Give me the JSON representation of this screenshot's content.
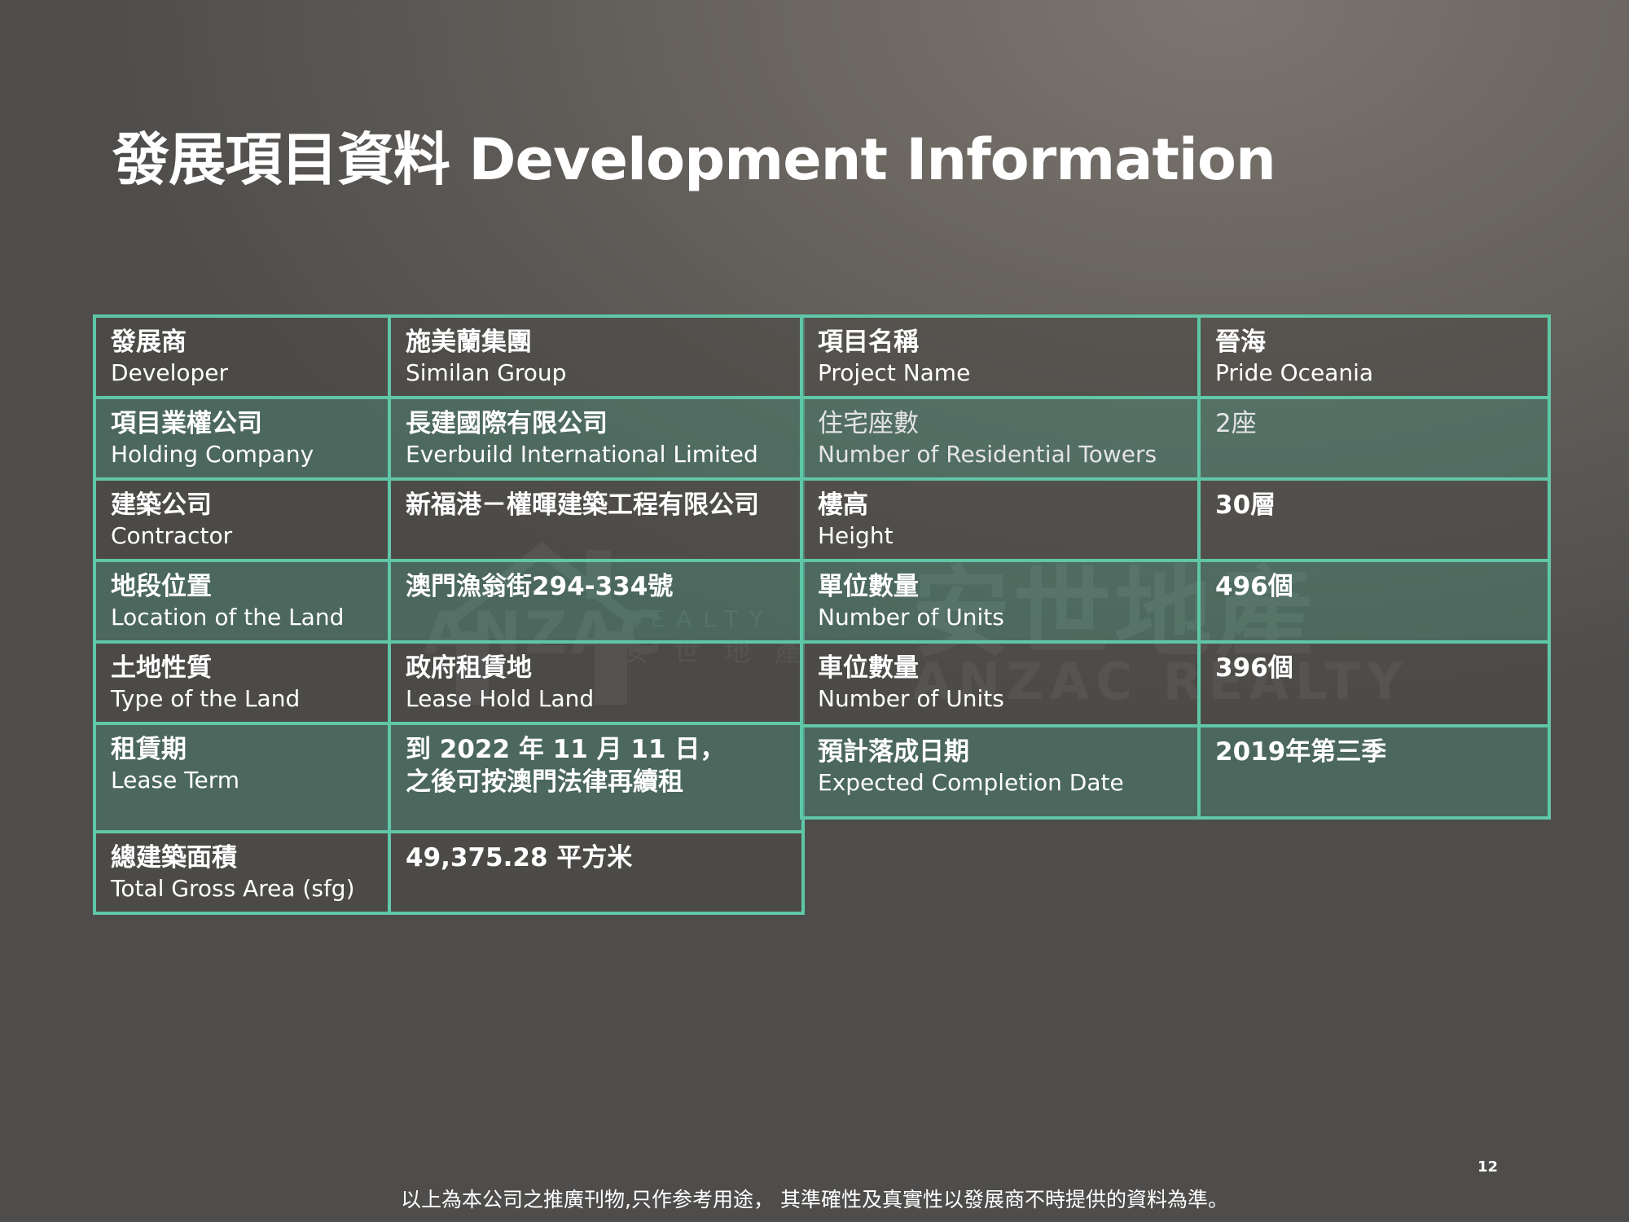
{
  "page": {
    "title": "發展項目資料 Development Information",
    "footer_note": "以上為本公司之推廣刊物,只作参考用途， 其準確性及真實性以發展商不時提供的資料為準。",
    "page_number": "12",
    "accent_color": "#5fc7a7"
  },
  "watermark": {
    "en_main": "ANZAC",
    "en_small": "REALTY",
    "cn_small": "安世地產",
    "cn_big": "安世地產",
    "en_big": "ANZAC REALTY"
  },
  "left_table": {
    "rows": [
      {
        "label_cn": "發展商",
        "label_en": "Developer",
        "value_cn": "施美蘭集團",
        "value_en": "Similan Group"
      },
      {
        "label_cn": "項目業權公司",
        "label_en": "Holding Company",
        "value_cn": "長建國際有限公司",
        "value_en": "Everbuild International Limited"
      },
      {
        "label_cn": "建築公司",
        "label_en": "Contractor",
        "value_cn": "新福港－權暉建築工程有限公司",
        "value_en": ""
      },
      {
        "label_cn": "地段位置",
        "label_en": "Location of the Land",
        "value_cn": "澳門漁翁街294-334號",
        "value_en": ""
      },
      {
        "label_cn": "土地性質",
        "label_en": "Type of the Land",
        "value_cn": "政府租賃地",
        "value_en": "Lease Hold Land"
      },
      {
        "label_cn": "租賃期",
        "label_en": "Lease Term",
        "value_cn": "到 2022 年 11 月 11 日，",
        "value_cn2": "之後可按澳門法律再續租"
      },
      {
        "label_cn": "總建築面積",
        "label_en": "Total Gross Area (sfg)",
        "value_cn": "49,375.28 平方米",
        "value_en": ""
      }
    ]
  },
  "right_table": {
    "rows": [
      {
        "label_cn": "項目名稱",
        "label_en": "Project Name",
        "value_cn": "晉海",
        "value_en": "Pride Oceania"
      },
      {
        "label_cn": "住宅座數",
        "label_en": "Number of Residential Towers",
        "value_cn": "2座",
        "value_en": ""
      },
      {
        "label_cn": "樓高",
        "label_en": "Height",
        "value_cn": "30層",
        "value_en": ""
      },
      {
        "label_cn": "單位數量",
        "label_en": "Number of Units",
        "value_cn": "496個",
        "value_en": ""
      },
      {
        "label_cn": "車位數量",
        "label_en": "Number of Units",
        "value_cn": "396個",
        "value_en": ""
      },
      {
        "label_cn": "預計落成日期",
        "label_en": "Expected Completion Date",
        "value_cn": "2019年第三季",
        "value_en": ""
      }
    ]
  }
}
